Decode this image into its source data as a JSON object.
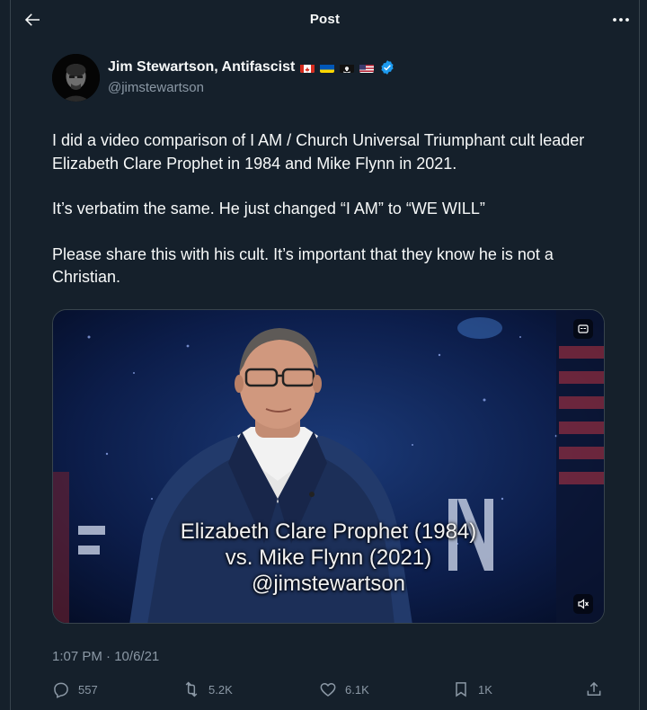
{
  "header": {
    "title": "Post",
    "back_icon": "arrow-left-icon",
    "more_icon": "more-horizontal-icon"
  },
  "author": {
    "name": "Jim Stewartson, Antifascist",
    "handle": "@jimstewartson",
    "flags": [
      "canada-flag-icon",
      "ukraine-flag-icon",
      "pirate-flag-icon",
      "usa-flag-icon"
    ],
    "verified_icon": "verified-badge-icon",
    "verified_color": "#1d9bf0"
  },
  "tweet": {
    "paragraphs": [
      "I did a video comparison of I AM / Church Universal Triumphant cult leader Elizabeth Clare Prophet in 1984 and Mike Flynn in 2021.",
      "It’s verbatim the same. He just changed “I AM” to “WE WILL”",
      "Please share this with his cult. It’s important that they know he is not a Christian."
    ]
  },
  "video": {
    "caption_line1": "Elizabeth Clare Prophet (1984)",
    "caption_line2": "vs. Mike Flynn (2021)",
    "caption_line3": "@jimstewartson",
    "top_right_icon": "caption-icon",
    "bottom_right_icon": "mute-icon"
  },
  "meta": {
    "time": "1:07 PM",
    "separator": "·",
    "date": "10/6/21"
  },
  "actions": {
    "replies": "557",
    "reposts": "5.2K",
    "likes": "6.1K",
    "bookmarks": "1K"
  },
  "colors": {
    "background": "#15202b",
    "border": "#38444d",
    "text": "#f7f9f9",
    "secondary_text": "#8b98a5"
  }
}
